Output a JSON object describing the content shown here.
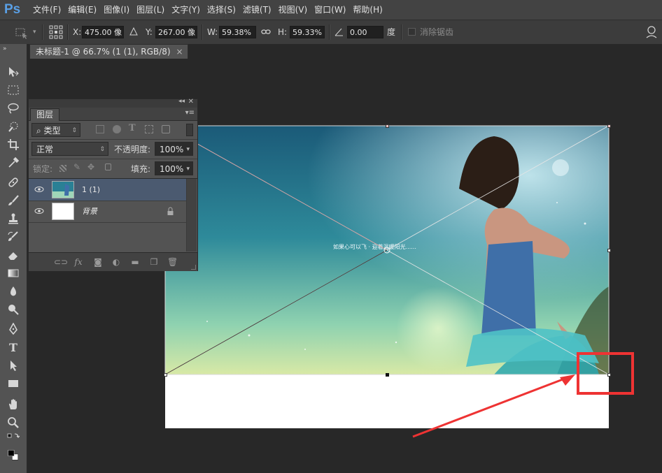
{
  "app": {
    "logo": "Ps"
  },
  "menubar": {
    "items": [
      "文件(F)",
      "编辑(E)",
      "图像(I)",
      "图层(L)",
      "文字(Y)",
      "选择(S)",
      "滤镜(T)",
      "视图(V)",
      "窗口(W)",
      "帮助(H)"
    ]
  },
  "options": {
    "x_label": "X:",
    "x_value": "475.00 像",
    "y_label": "Y:",
    "y_value": "267.00 像",
    "w_label": "W:",
    "w_value": "59.38%",
    "h_label": "H:",
    "h_value": "59.33%",
    "angle_value": "0.00",
    "angle_unit": "度",
    "antialias_label": "消除锯齿"
  },
  "document": {
    "tab_title": "未标题-1 @ 66.7% (1 (1), RGB/8)",
    "close_glyph": "×"
  },
  "layers_panel": {
    "tab_label": "图层",
    "filter_label": "类型",
    "blend_mode": "正常",
    "opacity_label": "不透明度:",
    "opacity_value": "100%",
    "lock_label": "锁定:",
    "fill_label": "填充:",
    "fill_value": "100%",
    "layers": [
      {
        "name": "1 (1)",
        "selected": true
      },
      {
        "name": "背景",
        "selected": false,
        "locked": true
      }
    ],
    "bottom_icons": [
      "link-icon",
      "fx-icon",
      "mask-icon",
      "adjustment-icon",
      "folder-icon",
      "new-layer-icon",
      "trash-icon"
    ]
  },
  "canvas": {
    "photo_caption": "如果心可以飞 · 迎着温暖阳光......",
    "annotation_color": "#ee3333"
  },
  "colors": {
    "accent": "#5aa0e6",
    "selected_layer": "#4b5a70",
    "annotation": "#ee3333"
  }
}
